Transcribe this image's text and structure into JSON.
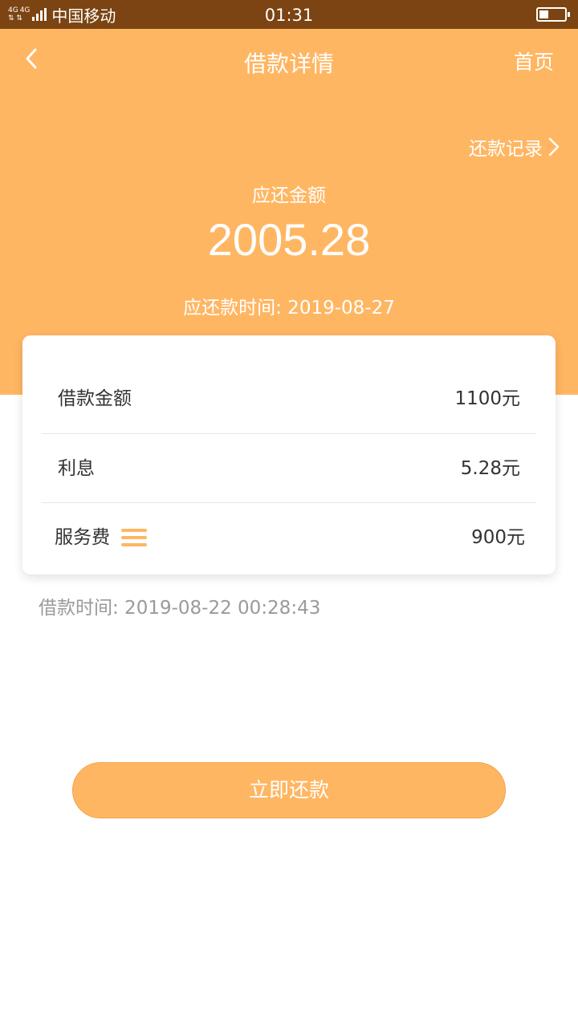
{
  "status_bar": {
    "network_1": "4G",
    "network_2": "4G",
    "carrier": "中国移动",
    "time": "01:31",
    "battery_level": 0.3
  },
  "nav": {
    "back_icon": "chevron-left-icon",
    "title": "借款详情",
    "home_label": "首页"
  },
  "summary": {
    "record_link": "还款记录",
    "due_label": "应还金额",
    "due_amount": "2005.28",
    "due_date": "应还款时间: 2019-08-27"
  },
  "details": {
    "rows": [
      {
        "label": "借款金额",
        "value": "1100元"
      },
      {
        "label": "利息",
        "value": "5.28元"
      },
      {
        "label": "服务费",
        "value": "900元"
      }
    ]
  },
  "loan_time": "借款时间: 2019-08-22 00:28:43",
  "action": {
    "repay_label": "立即还款"
  },
  "colors": {
    "header": "#ffb662",
    "status_bar": "#7b4412",
    "button": "#ffb662"
  }
}
